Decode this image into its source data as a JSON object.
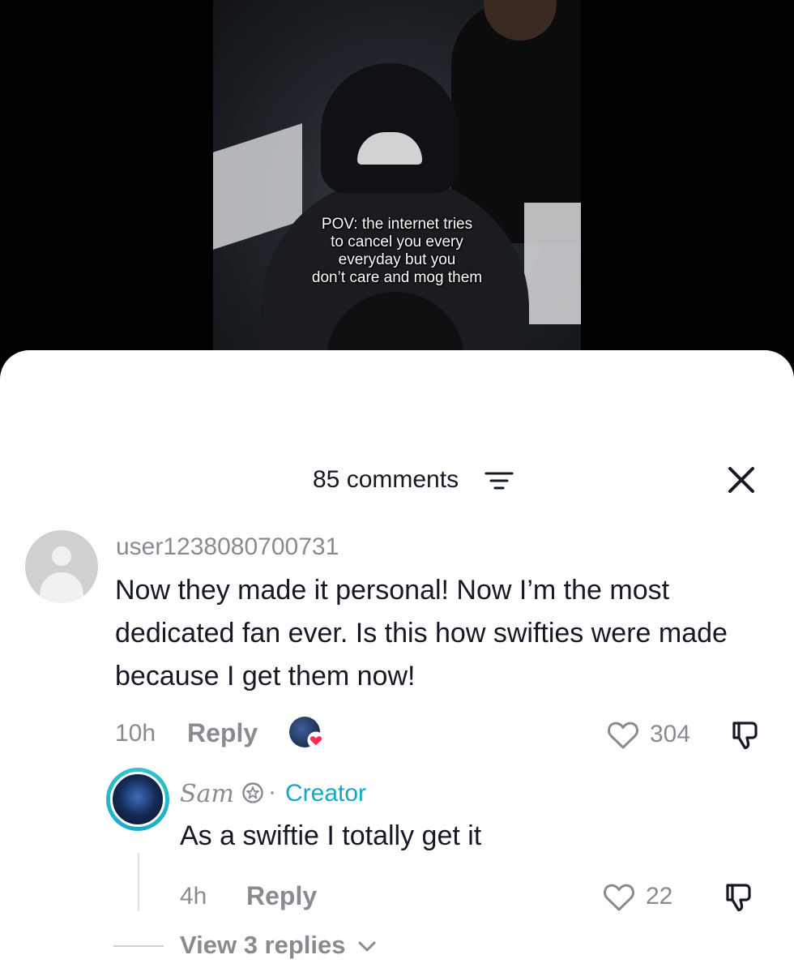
{
  "video": {
    "caption_lines": [
      "POV: the internet tries",
      "to cancel you every",
      "everyday but you",
      "don’t care and mog them"
    ]
  },
  "header": {
    "comments_count": "85 comments",
    "sort_icon": "sort-icon",
    "close_icon": "close-icon"
  },
  "comment": {
    "username": "user1238080700731",
    "text": "Now they made it personal! Now I’m the most dedicated fan ever. Is this how swifties were made because I get them now!",
    "time": "10h",
    "reply_label": "Reply",
    "like_count": "304",
    "creator_liked_icon": "creator-liked-icon"
  },
  "reply": {
    "username": "Sam",
    "separator": "·",
    "badge": "Creator",
    "text": "As a swiftie I totally get it",
    "time": "4h",
    "reply_label": "Reply",
    "like_count": "22"
  },
  "view_replies": "View 3 replies",
  "colors": {
    "text_primary": "#161823",
    "text_secondary": "#8a8b91",
    "creator_accent": "#1aa5c6",
    "heart_red": "#fe2c55"
  }
}
